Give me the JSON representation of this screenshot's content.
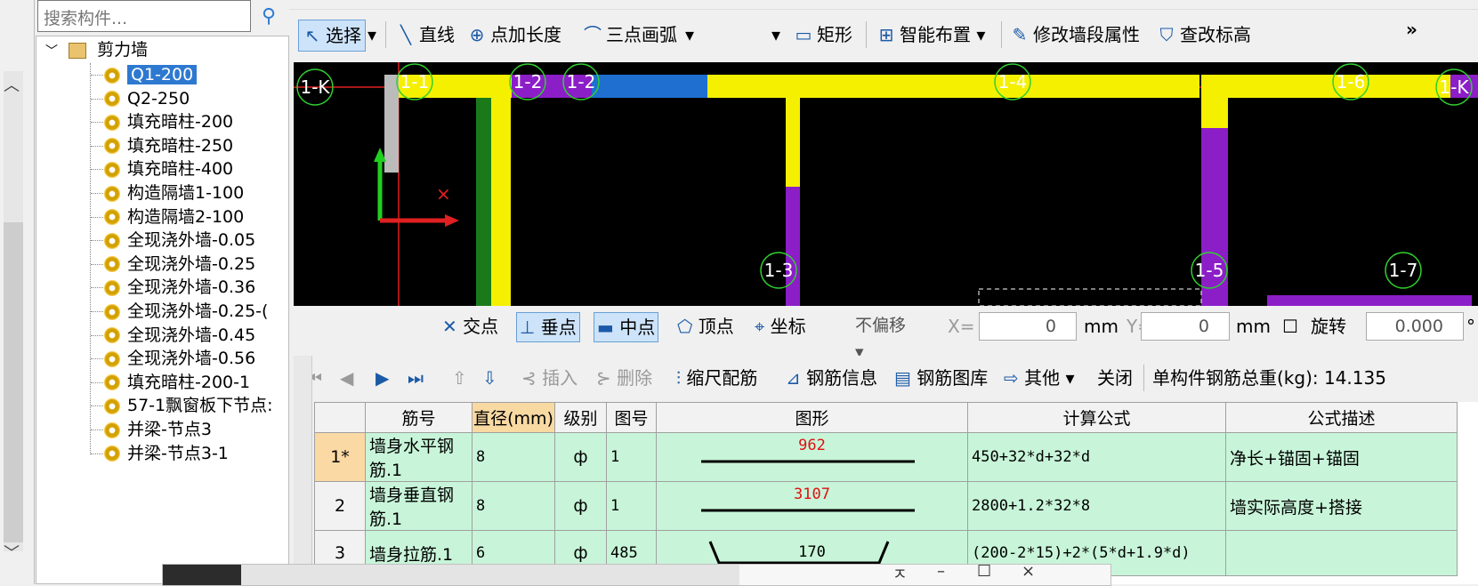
{
  "search": {
    "placeholder": "搜索构件..."
  },
  "tree": {
    "root": "剪力墙",
    "items": [
      "Q1-200",
      "Q2-250",
      "填充暗柱-200",
      "填充暗柱-250",
      "填充暗柱-400",
      "构造隔墙1-100",
      "构造隔墙2-100",
      "全现浇外墙-0.05",
      "全现浇外墙-0.25",
      "全现浇外墙-0.36",
      "全现浇外墙-0.25-(",
      "全现浇外墙-0.45",
      "全现浇外墙-0.56",
      "填充暗柱-200-1",
      "57-1飘窗板下节点:",
      "并梁-节点3",
      "并梁-节点3-1"
    ],
    "selected": "Q1-200"
  },
  "toolbar": {
    "select": "选择",
    "line": "直线",
    "point_length": "点加长度",
    "three_point_arc": "三点画弧",
    "rect": "矩形",
    "smart_layout": "智能布置",
    "modify_wall": "修改墙段属性",
    "check_elevation": "查改标高",
    "more": "»"
  },
  "canvas_labels": [
    "1-K",
    "1-1",
    "1-2",
    "1-2",
    "1-3",
    "1-4",
    "1-5",
    "1-6",
    "1-7",
    "1-K"
  ],
  "snap": {
    "intersection": "交点",
    "perpendicular": "垂点",
    "midpoint": "中点",
    "vertex": "顶点",
    "coordinate": "坐标",
    "offset": "不偏移",
    "x_label": "X=",
    "x_value": "0",
    "unit": "mm",
    "y_label": "Y=",
    "y_value": "0",
    "rotate_label": "旋转",
    "rotate_value": "0.000",
    "degree": "°"
  },
  "rebar_toolbar": {
    "insert": "插入",
    "delete": "删除",
    "scale_rebar": "缩尺配筋",
    "rebar_info": "钢筋信息",
    "rebar_library": "钢筋图库",
    "other": "其他",
    "close": "关闭",
    "total_weight_label": "单构件钢筋总重(kg):",
    "total_weight_value": "14.135"
  },
  "table": {
    "headers": [
      "筋号",
      "直径(mm)",
      "级别",
      "图号",
      "图形",
      "计算公式",
      "公式描述"
    ],
    "rows": [
      {
        "num": "1*",
        "name": "墙身水平钢筋.1",
        "diameter": "8",
        "grade": "ф",
        "figure": "1",
        "shape_value": "962",
        "formula": "450+32*d+32*d",
        "desc": "净长+锚固+锚固"
      },
      {
        "num": "2",
        "name": "墙身垂直钢筋.1",
        "diameter": "8",
        "grade": "ф",
        "figure": "1",
        "shape_value": "3107",
        "formula": "2800+1.2*32*8",
        "desc": "墙实际高度+搭接"
      },
      {
        "num": "3",
        "name": "墙身拉筋.1",
        "diameter": "6",
        "grade": "ф",
        "figure": "485",
        "shape_value": "170",
        "formula": "(200-2*15)+2*(5*d+1.9*d)",
        "desc": ""
      }
    ]
  },
  "popup": {
    "pin": "ㅈ",
    "min": "–",
    "max": "☐",
    "close": "×"
  }
}
